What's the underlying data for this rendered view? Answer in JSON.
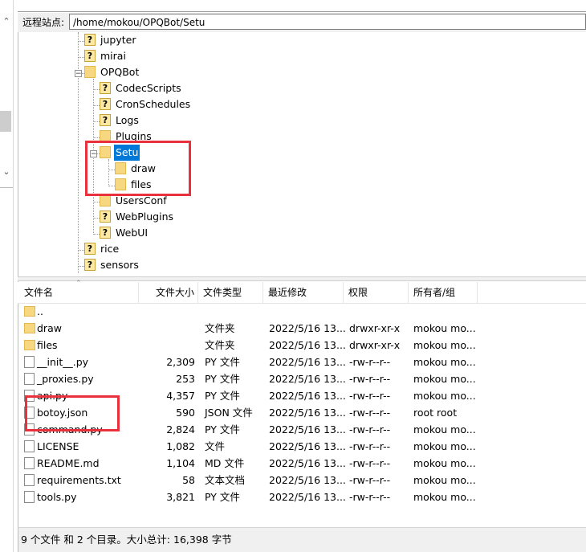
{
  "remote_site": {
    "label": "远程站点:",
    "path": "/home/mokou/OPQBot/Setu"
  },
  "tree": {
    "nodes": [
      {
        "name": "jupyter",
        "icon": "question-folder-icon"
      },
      {
        "name": "mirai",
        "icon": "question-folder-icon"
      },
      {
        "name": "OPQBot",
        "icon": "folder-icon",
        "expanded": true
      },
      {
        "name": "CodecScripts",
        "icon": "question-folder-icon"
      },
      {
        "name": "CronSchedules",
        "icon": "question-folder-icon"
      },
      {
        "name": "Logs",
        "icon": "question-folder-icon"
      },
      {
        "name": "Plugins",
        "icon": "folder-icon"
      },
      {
        "name": "Setu",
        "icon": "folder-icon",
        "selected": true,
        "expanded": true
      },
      {
        "name": "draw",
        "icon": "folder-icon"
      },
      {
        "name": "files",
        "icon": "folder-icon"
      },
      {
        "name": "UsersConf",
        "icon": "folder-icon"
      },
      {
        "name": "WebPlugins",
        "icon": "question-folder-icon"
      },
      {
        "name": "WebUI",
        "icon": "question-folder-icon"
      },
      {
        "name": "rice",
        "icon": "question-folder-icon"
      },
      {
        "name": "sensors",
        "icon": "question-folder-icon"
      }
    ]
  },
  "file_list": {
    "columns": [
      "文件名",
      "文件大小",
      "文件类型",
      "最近修改",
      "权限",
      "所有者/组"
    ],
    "rows": [
      {
        "name": "..",
        "size": "",
        "type": "",
        "modified": "",
        "perm": "",
        "owner": "",
        "icon": "folder-icon"
      },
      {
        "name": "draw",
        "size": "",
        "type": "文件夹",
        "modified": "2022/5/16 13...",
        "perm": "drwxr-xr-x",
        "owner": "mokou mo...",
        "icon": "folder-icon"
      },
      {
        "name": "files",
        "size": "",
        "type": "文件夹",
        "modified": "2022/5/16 13...",
        "perm": "drwxr-xr-x",
        "owner": "mokou mo...",
        "icon": "folder-icon"
      },
      {
        "name": "__init__.py",
        "size": "2,309",
        "type": "PY 文件",
        "modified": "2022/5/16 13...",
        "perm": "-rw-r--r--",
        "owner": "mokou mo...",
        "icon": "file-icon"
      },
      {
        "name": "_proxies.py",
        "size": "253",
        "type": "PY 文件",
        "modified": "2022/5/16 13...",
        "perm": "-rw-r--r--",
        "owner": "mokou mo...",
        "icon": "file-icon"
      },
      {
        "name": "api.py",
        "size": "4,357",
        "type": "PY 文件",
        "modified": "2022/5/16 13...",
        "perm": "-rw-r--r--",
        "owner": "mokou mo...",
        "icon": "file-icon"
      },
      {
        "name": "botoy.json",
        "size": "590",
        "type": "JSON 文件",
        "modified": "2022/5/16 13...",
        "perm": "-rw-r--r--",
        "owner": "root root",
        "icon": "file-icon"
      },
      {
        "name": "command.py",
        "size": "2,824",
        "type": "PY 文件",
        "modified": "2022/5/16 13...",
        "perm": "-rw-r--r--",
        "owner": "mokou mo...",
        "icon": "file-icon"
      },
      {
        "name": "LICENSE",
        "size": "1,082",
        "type": "文件",
        "modified": "2022/5/16 13...",
        "perm": "-rw-r--r--",
        "owner": "mokou mo...",
        "icon": "file-icon"
      },
      {
        "name": "README.md",
        "size": "1,104",
        "type": "MD 文件",
        "modified": "2022/5/16 13...",
        "perm": "-rw-r--r--",
        "owner": "mokou mo...",
        "icon": "file-icon"
      },
      {
        "name": "requirements.txt",
        "size": "58",
        "type": "文本文档",
        "modified": "2022/5/16 13...",
        "perm": "-rw-r--r--",
        "owner": "mokou mo...",
        "icon": "file-icon"
      },
      {
        "name": "tools.py",
        "size": "3,821",
        "type": "PY 文件",
        "modified": "2022/5/16 13...",
        "perm": "-rw-r--r--",
        "owner": "mokou mo...",
        "icon": "file-icon"
      }
    ]
  },
  "status": {
    "text": "9 个文件 和 2 个目录。大小总计: 16,398 字节"
  },
  "colors": {
    "selection": "#0078d7",
    "annotation_red": "#e8313c",
    "folder": "#f7d880"
  }
}
